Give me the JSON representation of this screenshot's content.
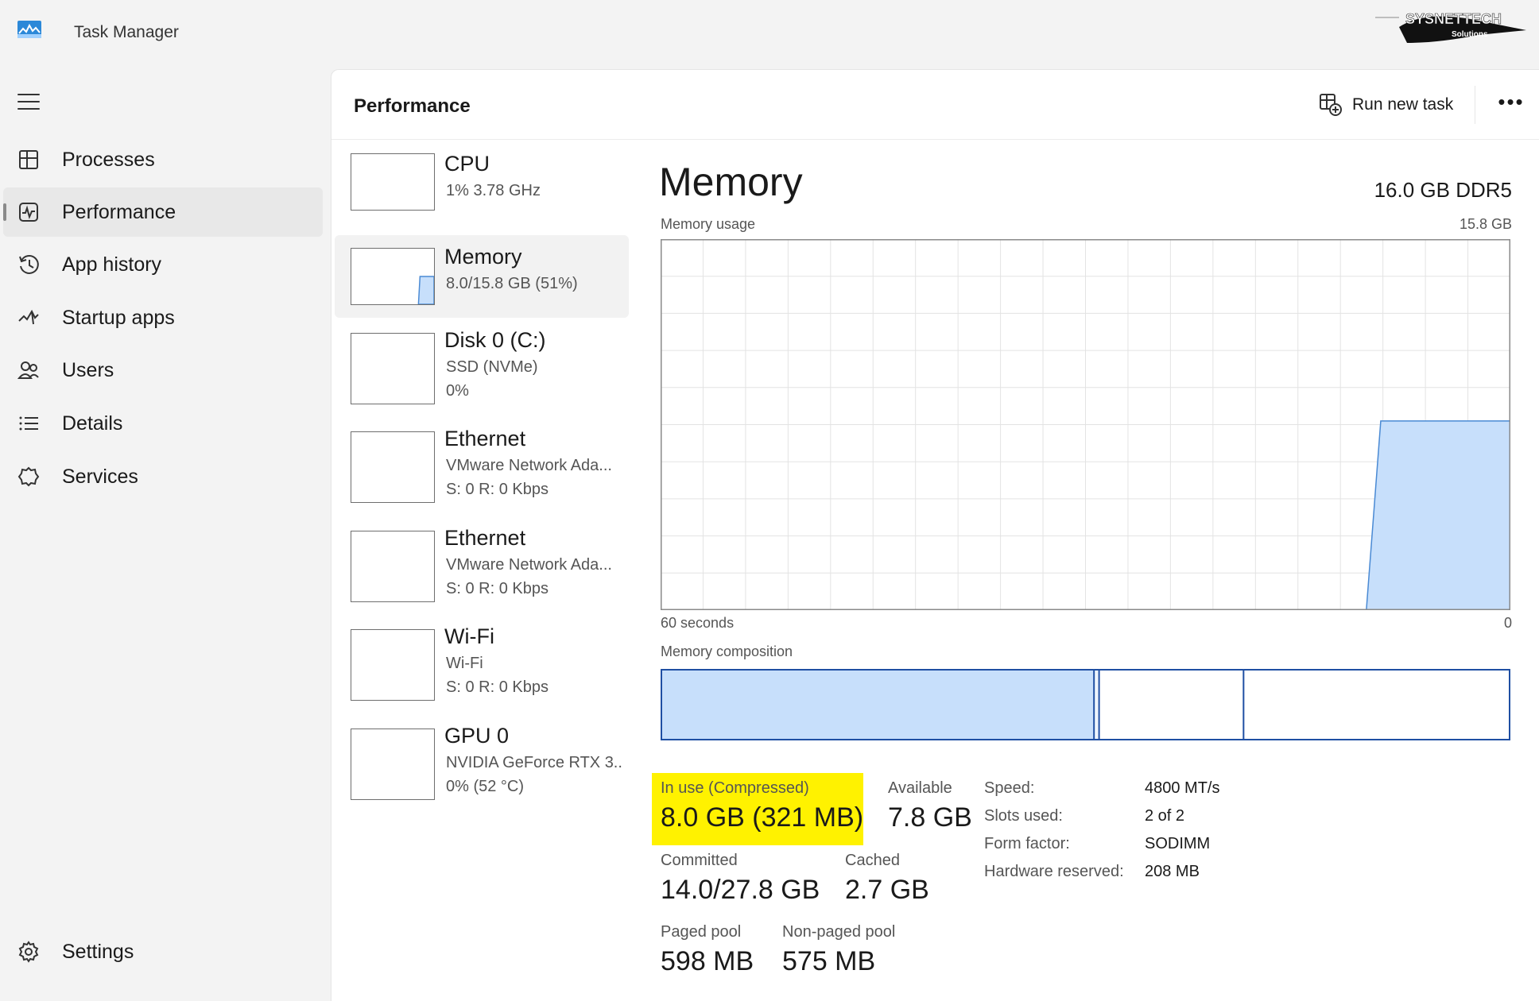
{
  "window": {
    "title": "Task Manager",
    "watermark": {
      "line1": "SYSNETTECH",
      "line2": "Solutions"
    }
  },
  "sidebar": {
    "items": [
      {
        "label": "Processes",
        "icon": "processes-icon"
      },
      {
        "label": "Performance",
        "icon": "performance-icon",
        "active": true
      },
      {
        "label": "App history",
        "icon": "history-icon"
      },
      {
        "label": "Startup apps",
        "icon": "startup-icon"
      },
      {
        "label": "Users",
        "icon": "users-icon"
      },
      {
        "label": "Details",
        "icon": "details-icon"
      },
      {
        "label": "Services",
        "icon": "services-icon"
      }
    ],
    "settings": {
      "label": "Settings",
      "icon": "settings-icon"
    }
  },
  "header": {
    "title": "Performance",
    "run_new_task": "Run new task",
    "more": "•••"
  },
  "devices": [
    {
      "name": "CPU",
      "sub1": "1%  3.78 GHz",
      "sub2": ""
    },
    {
      "name": "Memory",
      "sub1": "8.0/15.8 GB (51%)",
      "sub2": "",
      "active": true
    },
    {
      "name": "Disk 0 (C:)",
      "sub1": "SSD (NVMe)",
      "sub2": "0%"
    },
    {
      "name": "Ethernet",
      "sub1": "VMware Network Ada...",
      "sub2": "S: 0  R: 0 Kbps"
    },
    {
      "name": "Ethernet",
      "sub1": "VMware Network Ada...",
      "sub2": "S: 0  R: 0 Kbps"
    },
    {
      "name": "Wi-Fi",
      "sub1": "Wi-Fi",
      "sub2": "S: 0  R: 0 Kbps"
    },
    {
      "name": "GPU 0",
      "sub1": "NVIDIA GeForce RTX 3..",
      "sub2": "0%  (52 °C)"
    }
  ],
  "memory": {
    "title": "Memory",
    "total": "16.0 GB DDR5",
    "usage_label": "Memory usage",
    "usage_max": "15.8 GB",
    "time_left": "60 seconds",
    "time_right": "0",
    "composition_label": "Memory composition",
    "usage_history_fraction": [
      0,
      0,
      0,
      0,
      0,
      0,
      0,
      0,
      0,
      0,
      0,
      0,
      0,
      0,
      0,
      0,
      0,
      0,
      0,
      0,
      0,
      0,
      0,
      0,
      0,
      0,
      0,
      0,
      0,
      0,
      0,
      0,
      0,
      0,
      0,
      0,
      0,
      0,
      0,
      0,
      0,
      0,
      0,
      0,
      0,
      0,
      0,
      0,
      0,
      0,
      0.51,
      0.51,
      0.51,
      0.51,
      0.51,
      0.51,
      0.51,
      0.51,
      0.51,
      0.51
    ],
    "composition_fractions": {
      "in_use": 0.51,
      "modified": 0.006,
      "standby": 0.17
    },
    "stats": {
      "in_use_label": "In use (Compressed)",
      "in_use_value": "8.0 GB (321 MB)",
      "available_label": "Available",
      "available_value": "7.8 GB",
      "committed_label": "Committed",
      "committed_value": "14.0/27.8 GB",
      "cached_label": "Cached",
      "cached_value": "2.7 GB",
      "paged_label": "Paged pool",
      "paged_value": "598 MB",
      "nonpaged_label": "Non-paged pool",
      "nonpaged_value": "575 MB"
    },
    "specs": [
      {
        "label": "Speed:",
        "value": "4800 MT/s"
      },
      {
        "label": "Slots used:",
        "value": "2 of 2"
      },
      {
        "label": "Form factor:",
        "value": "SODIMM"
      },
      {
        "label": "Hardware reserved:",
        "value": "208 MB"
      }
    ]
  },
  "colors": {
    "graph_fill": "#c7dffb",
    "graph_line": "#4a8ad4",
    "comp_border": "#1f4fa3",
    "highlight": "#fff200"
  }
}
